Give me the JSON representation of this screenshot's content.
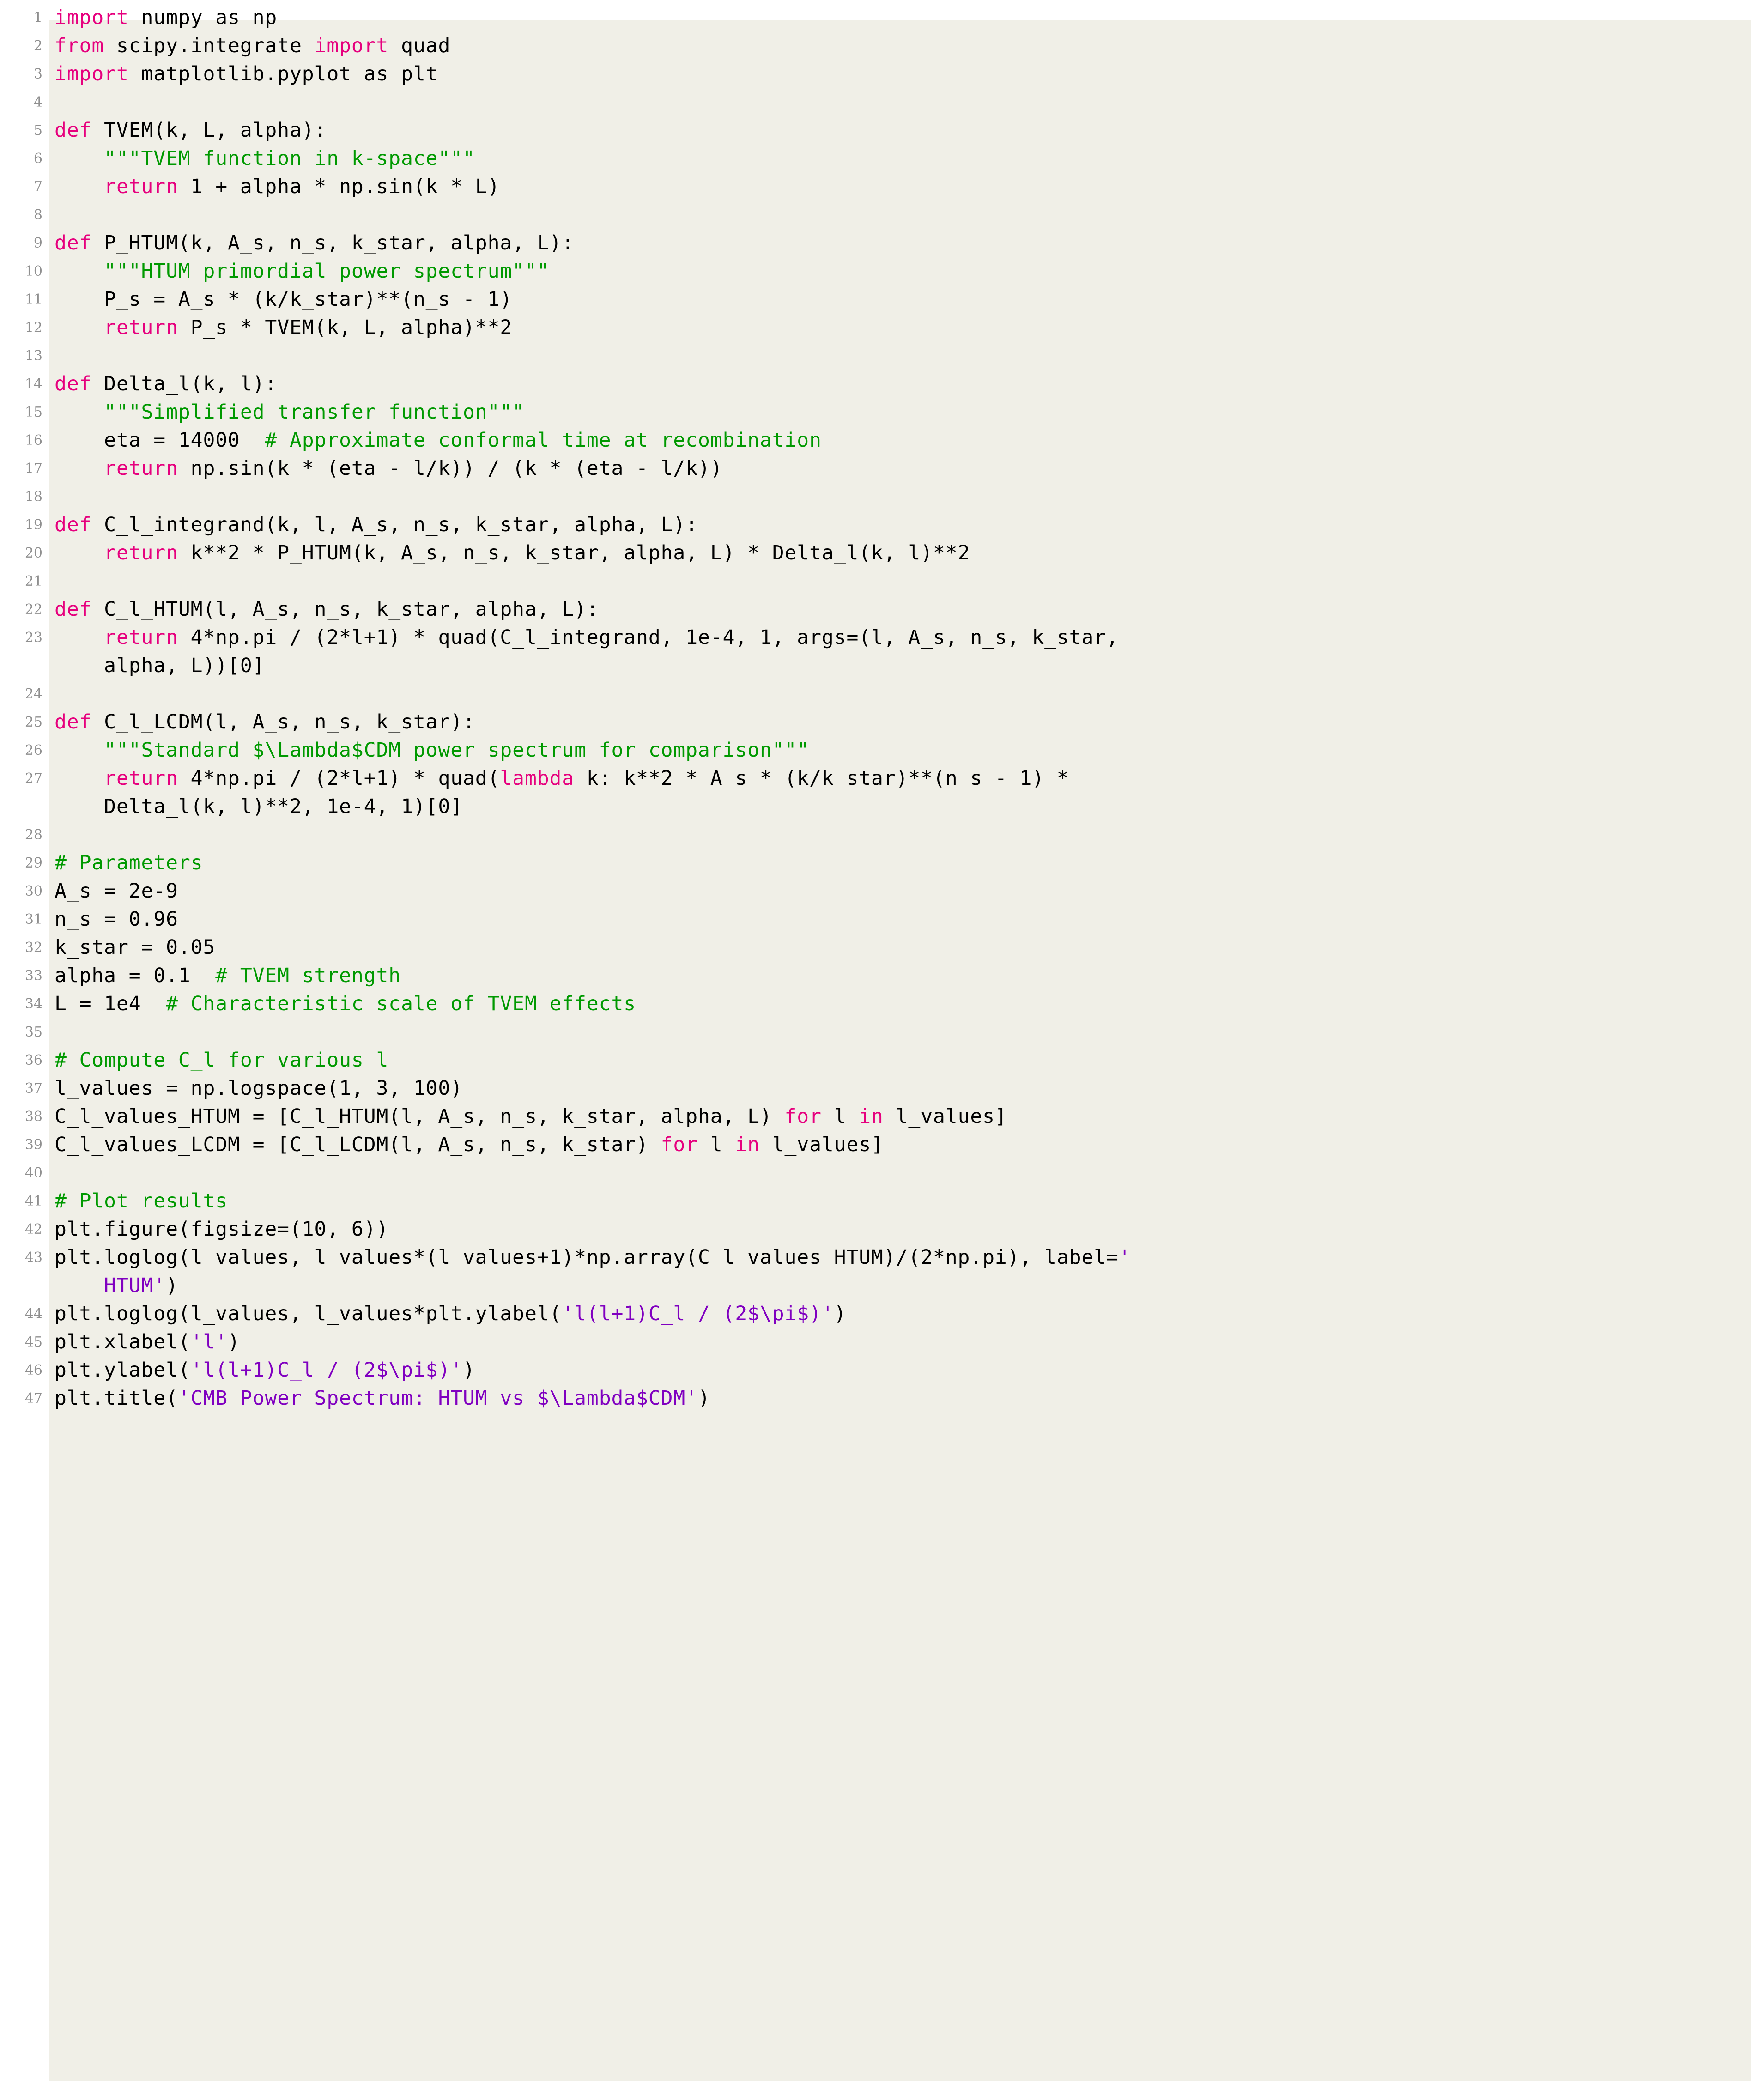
{
  "listing": {
    "language": "Python",
    "background_color": "#f0efe7",
    "page_background": "#ffffff",
    "colors": {
      "keyword": "#e6007e",
      "comment": "#009900",
      "string": "#8000c0",
      "normal": "#000000",
      "line_number": "#8f8f8f"
    },
    "first_line_number": 1,
    "last_line_number": 47,
    "lines": [
      {
        "n": "1",
        "tokens": [
          {
            "t": "kw",
            "v": "import"
          },
          {
            "t": "nm",
            "v": " numpy as np"
          }
        ]
      },
      {
        "n": "2",
        "tokens": [
          {
            "t": "kw",
            "v": "from"
          },
          {
            "t": "nm",
            "v": " scipy.integrate "
          },
          {
            "t": "kw",
            "v": "import"
          },
          {
            "t": "nm",
            "v": " quad"
          }
        ]
      },
      {
        "n": "3",
        "tokens": [
          {
            "t": "kw",
            "v": "import"
          },
          {
            "t": "nm",
            "v": " matplotlib.pyplot as plt"
          }
        ]
      },
      {
        "n": "4",
        "tokens": []
      },
      {
        "n": "5",
        "tokens": [
          {
            "t": "kw",
            "v": "def"
          },
          {
            "t": "nm",
            "v": " TVEM(k, L, alpha):"
          }
        ]
      },
      {
        "n": "6",
        "tokens": [
          {
            "t": "nm",
            "v": "    "
          },
          {
            "t": "cm",
            "v": "\"\"\"TVEM function in k-space\"\"\""
          }
        ]
      },
      {
        "n": "7",
        "tokens": [
          {
            "t": "nm",
            "v": "    "
          },
          {
            "t": "kw",
            "v": "return"
          },
          {
            "t": "nm",
            "v": " 1 + alpha * np.sin(k * L)"
          }
        ]
      },
      {
        "n": "8",
        "tokens": []
      },
      {
        "n": "9",
        "tokens": [
          {
            "t": "kw",
            "v": "def"
          },
          {
            "t": "nm",
            "v": " P_HTUM(k, A_s, n_s, k_star, alpha, L):"
          }
        ]
      },
      {
        "n": "10",
        "tokens": [
          {
            "t": "nm",
            "v": "    "
          },
          {
            "t": "cm",
            "v": "\"\"\"HTUM primordial power spectrum\"\"\""
          }
        ]
      },
      {
        "n": "11",
        "tokens": [
          {
            "t": "nm",
            "v": "    P_s = A_s * (k/k_star)**(n_s - 1)"
          }
        ]
      },
      {
        "n": "12",
        "tokens": [
          {
            "t": "nm",
            "v": "    "
          },
          {
            "t": "kw",
            "v": "return"
          },
          {
            "t": "nm",
            "v": " P_s * TVEM(k, L, alpha)**2"
          }
        ]
      },
      {
        "n": "13",
        "tokens": []
      },
      {
        "n": "14",
        "tokens": [
          {
            "t": "kw",
            "v": "def"
          },
          {
            "t": "nm",
            "v": " Delta_l(k, l):"
          }
        ]
      },
      {
        "n": "15",
        "tokens": [
          {
            "t": "nm",
            "v": "    "
          },
          {
            "t": "cm",
            "v": "\"\"\"Simplified transfer function\"\"\""
          }
        ]
      },
      {
        "n": "16",
        "tokens": [
          {
            "t": "nm",
            "v": "    eta = 14000  "
          },
          {
            "t": "cm",
            "v": "# Approximate conformal time at recombination"
          }
        ]
      },
      {
        "n": "17",
        "tokens": [
          {
            "t": "nm",
            "v": "    "
          },
          {
            "t": "kw",
            "v": "return"
          },
          {
            "t": "nm",
            "v": " np.sin(k * (eta - l/k)) / (k * (eta - l/k))"
          }
        ]
      },
      {
        "n": "18",
        "tokens": []
      },
      {
        "n": "19",
        "tokens": [
          {
            "t": "kw",
            "v": "def"
          },
          {
            "t": "nm",
            "v": " C_l_integrand(k, l, A_s, n_s, k_star, alpha, L):"
          }
        ]
      },
      {
        "n": "20",
        "tokens": [
          {
            "t": "nm",
            "v": "    "
          },
          {
            "t": "kw",
            "v": "return"
          },
          {
            "t": "nm",
            "v": " k**2 * P_HTUM(k, A_s, n_s, k_star, alpha, L) * Delta_l(k, l)**2"
          }
        ]
      },
      {
        "n": "21",
        "tokens": []
      },
      {
        "n": "22",
        "tokens": [
          {
            "t": "kw",
            "v": "def"
          },
          {
            "t": "nm",
            "v": " C_l_HTUM(l, A_s, n_s, k_star, alpha, L):"
          }
        ]
      },
      {
        "n": "23",
        "tokens": [
          {
            "t": "nm",
            "v": "    "
          },
          {
            "t": "kw",
            "v": "return"
          },
          {
            "t": "nm",
            "v": " 4*np.pi / (2*l+1) * quad(C_l_integrand, 1e-4, 1, args=(l, A_s, n_s, k_star,"
          }
        ]
      },
      {
        "n": "",
        "cont": true,
        "tokens": [
          {
            "t": "nm",
            "v": "    alpha, L))[0]"
          }
        ]
      },
      {
        "n": "24",
        "tokens": []
      },
      {
        "n": "25",
        "tokens": [
          {
            "t": "kw",
            "v": "def"
          },
          {
            "t": "nm",
            "v": " C_l_LCDM(l, A_s, n_s, k_star):"
          }
        ]
      },
      {
        "n": "26",
        "tokens": [
          {
            "t": "nm",
            "v": "    "
          },
          {
            "t": "cm",
            "v": "\"\"\"Standard $\\Lambda$CDM power spectrum for comparison\"\"\""
          }
        ]
      },
      {
        "n": "27",
        "tokens": [
          {
            "t": "nm",
            "v": "    "
          },
          {
            "t": "kw",
            "v": "return"
          },
          {
            "t": "nm",
            "v": " 4*np.pi / (2*l+1) * quad("
          },
          {
            "t": "kw",
            "v": "lambda"
          },
          {
            "t": "nm",
            "v": " k: k**2 * A_s * (k/k_star)**(n_s - 1) *"
          }
        ]
      },
      {
        "n": "",
        "cont": true,
        "tokens": [
          {
            "t": "nm",
            "v": "    Delta_l(k, l)**2, 1e-4, 1)[0]"
          }
        ]
      },
      {
        "n": "28",
        "tokens": []
      },
      {
        "n": "29",
        "tokens": [
          {
            "t": "cm",
            "v": "# Parameters"
          }
        ]
      },
      {
        "n": "30",
        "tokens": [
          {
            "t": "nm",
            "v": "A_s = 2e-9"
          }
        ]
      },
      {
        "n": "31",
        "tokens": [
          {
            "t": "nm",
            "v": "n_s = 0.96"
          }
        ]
      },
      {
        "n": "32",
        "tokens": [
          {
            "t": "nm",
            "v": "k_star = 0.05"
          }
        ]
      },
      {
        "n": "33",
        "tokens": [
          {
            "t": "nm",
            "v": "alpha = 0.1  "
          },
          {
            "t": "cm",
            "v": "# TVEM strength"
          }
        ]
      },
      {
        "n": "34",
        "tokens": [
          {
            "t": "nm",
            "v": "L = 1e4  "
          },
          {
            "t": "cm",
            "v": "# Characteristic scale of TVEM effects"
          }
        ]
      },
      {
        "n": "35",
        "tokens": []
      },
      {
        "n": "36",
        "tokens": [
          {
            "t": "cm",
            "v": "# Compute C_l for various l"
          }
        ]
      },
      {
        "n": "37",
        "tokens": [
          {
            "t": "nm",
            "v": "l_values = np.logspace(1, 3, 100)"
          }
        ]
      },
      {
        "n": "38",
        "tokens": [
          {
            "t": "nm",
            "v": "C_l_values_HTUM = [C_l_HTUM(l, A_s, n_s, k_star, alpha, L) "
          },
          {
            "t": "kw",
            "v": "for"
          },
          {
            "t": "nm",
            "v": " l "
          },
          {
            "t": "kw",
            "v": "in"
          },
          {
            "t": "nm",
            "v": " l_values]"
          }
        ]
      },
      {
        "n": "39",
        "tokens": [
          {
            "t": "nm",
            "v": "C_l_values_LCDM = [C_l_LCDM(l, A_s, n_s, k_star) "
          },
          {
            "t": "kw",
            "v": "for"
          },
          {
            "t": "nm",
            "v": " l "
          },
          {
            "t": "kw",
            "v": "in"
          },
          {
            "t": "nm",
            "v": " l_values]"
          }
        ]
      },
      {
        "n": "40",
        "tokens": []
      },
      {
        "n": "41",
        "tokens": [
          {
            "t": "cm",
            "v": "# Plot results"
          }
        ]
      },
      {
        "n": "42",
        "tokens": [
          {
            "t": "nm",
            "v": "plt.figure(figsize=(10, 6))"
          }
        ]
      },
      {
        "n": "43",
        "tokens": [
          {
            "t": "nm",
            "v": "plt.loglog(l_values, l_values*(l_values+1)*np.array(C_l_values_HTUM)/(2*np.pi), label="
          },
          {
            "t": "str",
            "v": "'"
          }
        ]
      },
      {
        "n": "",
        "cont": true,
        "tokens": [
          {
            "t": "nm",
            "v": "    "
          },
          {
            "t": "str",
            "v": "HTUM'"
          },
          {
            "t": "nm",
            "v": ")"
          }
        ]
      },
      {
        "n": "44",
        "tokens": [
          {
            "t": "nm",
            "v": "plt.loglog(l_values, l_values*plt.ylabel("
          },
          {
            "t": "str",
            "v": "'l(l+1)C_l / (2$\\pi$)'"
          },
          {
            "t": "nm",
            "v": ")"
          }
        ]
      },
      {
        "n": "45",
        "tokens": [
          {
            "t": "nm",
            "v": "plt.xlabel("
          },
          {
            "t": "str",
            "v": "'l'"
          },
          {
            "t": "nm",
            "v": ")"
          }
        ]
      },
      {
        "n": "46",
        "tokens": [
          {
            "t": "nm",
            "v": "plt.ylabel("
          },
          {
            "t": "str",
            "v": "'l(l+1)C_l / (2$\\pi$)'"
          },
          {
            "t": "nm",
            "v": ")"
          }
        ]
      },
      {
        "n": "47",
        "tokens": [
          {
            "t": "nm",
            "v": "plt.title("
          },
          {
            "t": "str",
            "v": "'CMB Power Spectrum: HTUM vs $\\Lambda$CDM'"
          },
          {
            "t": "nm",
            "v": ")"
          }
        ]
      }
    ]
  }
}
